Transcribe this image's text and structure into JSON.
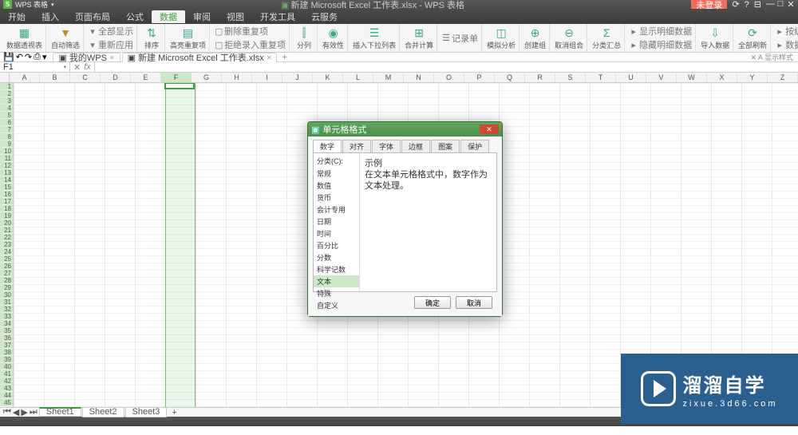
{
  "app": {
    "logo": "S",
    "name": "WPS 表格",
    "docTitle": "新建 Microsoft Excel 工作表.xlsx - WPS 表格",
    "docIcon": "▣",
    "login": "未登录"
  },
  "menu": [
    "开始",
    "插入",
    "页面布局",
    "公式",
    "数据",
    "审阅",
    "视图",
    "开发工具",
    "云服务"
  ],
  "activeMenu": 4,
  "ribbon": {
    "pivot": {
      "label": "数据透视表"
    },
    "autofilter": {
      "label": "自动筛选"
    },
    "filterStack": [
      "全部显示",
      "重新应用"
    ],
    "sort": {
      "label": "排序"
    },
    "dedup": {
      "label": "高亮重复项"
    },
    "delDup": [
      "删除重复项",
      "拒绝录入重复项"
    ],
    "split": {
      "label": "分列"
    },
    "valid": {
      "label": "有效性"
    },
    "dropdown": {
      "label": "插入下拉列表"
    },
    "consol": {
      "label": "合并计算"
    },
    "record": [
      "记录单"
    ],
    "whatif": {
      "label": "模拟分析"
    },
    "group": {
      "label": "创建组"
    },
    "ungroup": {
      "label": "取消组合"
    },
    "subtotal": {
      "label": "分类汇总"
    },
    "detailStack": [
      "显示明细数据",
      "隐藏明细数据"
    ],
    "import": {
      "label": "导入数据"
    },
    "refresh": {
      "label": "全部刷新"
    },
    "advStack": [
      "按级排序",
      "数据区域设置"
    ]
  },
  "tabs": [
    {
      "icon": "▣",
      "label": "我的WPS"
    },
    {
      "icon": "▣",
      "label": "新建 Microsoft Excel 工作表.xlsx",
      "active": true
    }
  ],
  "tabRight": "✕ A 显示样式",
  "nameBox": "F1",
  "cols": [
    "A",
    "B",
    "C",
    "D",
    "E",
    "F",
    "G",
    "H",
    "I",
    "J",
    "K",
    "L",
    "M",
    "N",
    "O",
    "P",
    "Q",
    "R",
    "S",
    "T",
    "U",
    "V",
    "W",
    "X",
    "Y",
    "Z"
  ],
  "selColIndex": 5,
  "rowCount": 45,
  "sheets": [
    "Sheet1",
    "Sheet2",
    "Sheet3"
  ],
  "dialog": {
    "title": "单元格格式",
    "tabs": [
      "数字",
      "对齐",
      "字体",
      "边框",
      "图案",
      "保护"
    ],
    "activeTab": 0,
    "catLabel": "分类(C):",
    "categories": [
      "常规",
      "数值",
      "货币",
      "会计专用",
      "日期",
      "时间",
      "百分比",
      "分数",
      "科学记数",
      "文本",
      "特殊",
      "自定义"
    ],
    "selectedCategory": 9,
    "sampleLabel": "示例",
    "desc": "在文本单元格格式中，数字作为文本处理。",
    "ok": "确定",
    "cancel": "取消"
  },
  "watermark": {
    "big": "溜溜自学",
    "small": "zixue.3d66.com"
  }
}
